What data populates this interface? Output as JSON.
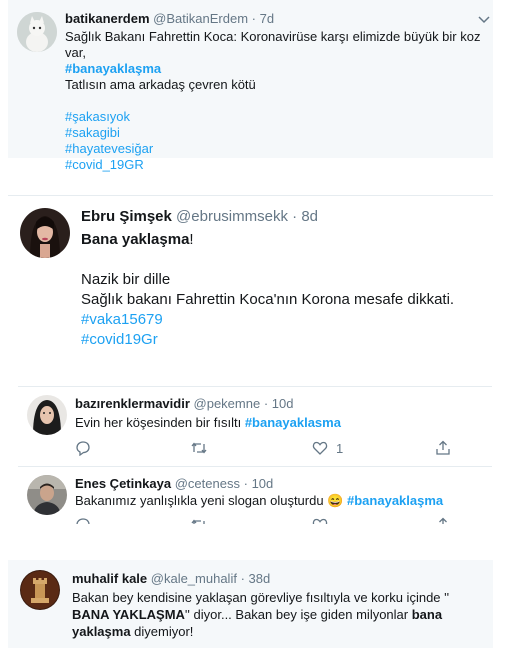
{
  "tweet1": {
    "name": "batikanerdem",
    "handle": "@BatikanErdem",
    "dot": "·",
    "time": "7d",
    "line1": "Sağlık Bakanı Fahrettin Koca: Koronavirüse karşı elimizde büyük bir koz var,",
    "hashtag_main": "#banayaklaşma",
    "line2": "Tatlısın ama arkadaş çevren kötü",
    "hashtags": [
      "#şakasıyok",
      "#sakagibi",
      "#hayatevesiğar",
      "#covid_19GR"
    ]
  },
  "tweet2": {
    "name": "Ebru Şimşek",
    "handle": "@ebrusimmsekk",
    "dot": "·",
    "time": "8d",
    "title_bold": "Bana yaklaşma",
    "title_end": "!",
    "line1": "Nazik bir dille",
    "line2": "Sağlık bakanı Fahrettin Koca'nın Korona mesafe dikkati.",
    "hashtags": [
      "#vaka15679",
      "#covid19Gr"
    ]
  },
  "tweet3": {
    "name": "bazırenklermavidir",
    "handle": "@pekemne",
    "dot": "·",
    "time": "10d",
    "text": "Evin her köşesinden bir fısıltı",
    "hashtag": "#banayaklasma",
    "like_count": "1"
  },
  "tweet4": {
    "name": "Enes Çetinkaya",
    "handle": "@ceteness",
    "dot": "·",
    "time": "10d",
    "text": "Bakanımız yanlışlıkla yeni slogan oluşturdu",
    "emoji": "😄",
    "hashtag": "#banayaklaşma"
  },
  "tweet5": {
    "name": "muhalif kale",
    "handle": "@kale_muhalif",
    "dot": "·",
    "time": "38d",
    "p1": "Bakan bey kendisine yaklaşan görevliye fısıltıyla ve korku içinde '' ",
    "b1": "BANA YAKLAŞMA",
    "p2": "'' diyor...  Bakan bey işe giden milyonlar ",
    "b2": "bana yaklaşma",
    "p3": " diyemiyor!"
  },
  "icons": [
    "chevron-down-icon",
    "reply-icon",
    "retweet-icon",
    "like-icon",
    "share-icon"
  ],
  "colors": {
    "link": "#1da1f2",
    "muted": "#657786",
    "card_bg": "#f5f8fa"
  }
}
